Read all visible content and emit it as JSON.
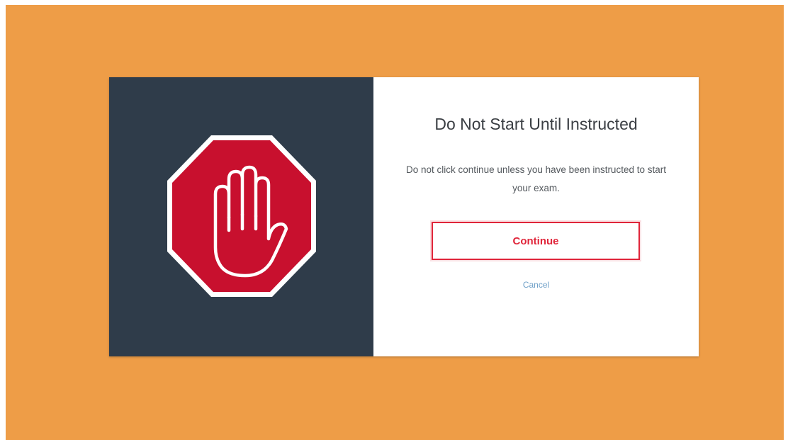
{
  "dialog": {
    "title": "Do Not Start Until Instructed",
    "message": "Do not click continue unless you have been instructed to start your exam.",
    "continue_label": "Continue",
    "cancel_label": "Cancel",
    "icon": "stop-hand-icon"
  },
  "colors": {
    "backdrop": "#ee9d47",
    "panel_dark": "#2f3c4a",
    "stop_red": "#c8102e",
    "accent_red": "#e0253a",
    "link_blue": "#6fa0c8"
  }
}
